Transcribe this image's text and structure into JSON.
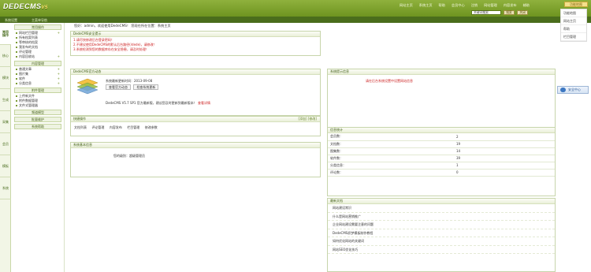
{
  "header": {
    "logo": "DEDECMS",
    "logo_version": "V5",
    "links": [
      "网站主页",
      "系统主页",
      "帮助",
      "会员中心",
      "注销",
      "网站管理",
      "内容发布",
      "辅助"
    ],
    "top_button": "功能地图",
    "search_value": "关键词搜索",
    "search_button": "搜索",
    "close_button": "关闭"
  },
  "subbar": {
    "left": "系统设置",
    "mid": "主菜单导航"
  },
  "vtabs": [
    "常用操作",
    "核心",
    "模块",
    "生成",
    "采集",
    "会员",
    "模板",
    "系统"
  ],
  "menu": {
    "sections": [
      {
        "title": "常用操作",
        "items": [
          {
            "label": "网站栏目管理",
            "plus": "+"
          },
          {
            "label": "所有档案列表",
            "plus": ""
          },
          {
            "label": "等审核的档案",
            "plus": ""
          },
          {
            "label": "我发布的文档",
            "plus": ""
          },
          {
            "label": "评论管理",
            "plus": ""
          },
          {
            "label": "内容回收站",
            "plus": "+"
          }
        ]
      },
      {
        "title": "内容管理",
        "items": [
          {
            "label": "普通文章",
            "plus": "+"
          },
          {
            "label": "图片集",
            "plus": "+"
          },
          {
            "label": "软件",
            "plus": "+"
          },
          {
            "label": "分类信息",
            "plus": "+"
          }
        ]
      },
      {
        "title": "附件管理",
        "items": [
          {
            "label": "上传新文件",
            "plus": ""
          },
          {
            "label": "附件数据管理",
            "plus": ""
          },
          {
            "label": "文件式管理器",
            "plus": ""
          }
        ]
      },
      {
        "title": "频道模型",
        "items": []
      },
      {
        "title": "批量维护",
        "items": []
      },
      {
        "title": "系统帮助",
        "items": []
      }
    ]
  },
  "main": {
    "welcome": "您好：admin，欢迎使用DedeCMS！ 您现在所在位置：系统主页",
    "security": {
      "title": "DedeCMS安全提示",
      "lines": [
        "1.请尽快修改后台登录密码！",
        "2.不建议使用DedeCMS的默认后台路径(/dede)，请修改！",
        "3.系统检测到您的数据库存在安全隐患，请及时处理！"
      ]
    },
    "official": {
      "title": "DedeCMS官方动态",
      "update_text": "系统最新更新时间：2013-09-08",
      "btn1": "查看官方动态",
      "btn2": "检查系统更新",
      "version_text": "DedeCMS V5.7 SP1 官方最新版，建议您及时更新到最新版本！",
      "version_link": "查看详情"
    },
    "tips": {
      "title": "系统提示信息",
      "text": "请在后台系统设置中设置网站信息"
    },
    "quick": {
      "title": "快捷操作",
      "right": "[添加] [修改]",
      "items": [
        "文档列表",
        "评论管理",
        "内容发布",
        "栏目管理",
        "修改参数"
      ]
    },
    "sysinfo": {
      "title": "系统基本信息",
      "text": "您的级别：超级管理员"
    },
    "stats": {
      "title": "信息统计",
      "rows": [
        {
          "label": "会员数：",
          "value": "2"
        },
        {
          "label": "文档数：",
          "value": "19"
        },
        {
          "label": "图集数：",
          "value": "14"
        },
        {
          "label": "软件数：",
          "value": "39"
        },
        {
          "label": "分类信息：",
          "value": "1"
        },
        {
          "label": "评论数：",
          "value": "0"
        }
      ]
    },
    "latest": {
      "title": "最新文档",
      "items": [
        "网站建设常识",
        "什么是网站营销推广",
        "企业网站建设需要注意的问题",
        "DedeCMS织梦模板制作教程",
        "如何优化网站的关键词",
        "网站SEO优化技巧"
      ]
    },
    "side_button": "安全中心"
  },
  "right_list": [
    "功能地图",
    "网站主页",
    "帮助",
    "栏目管理"
  ]
}
